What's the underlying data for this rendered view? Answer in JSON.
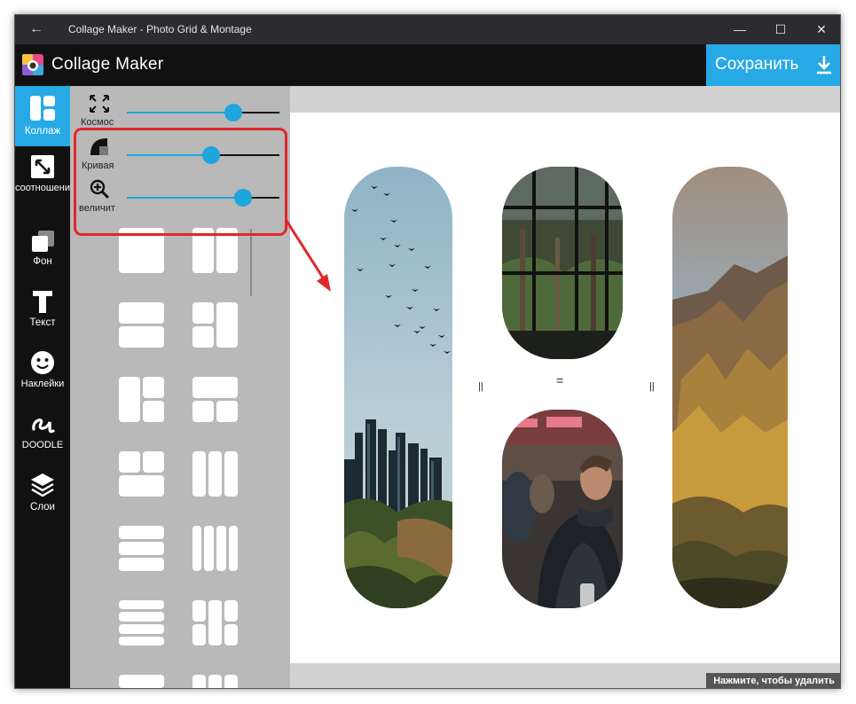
{
  "window": {
    "title": "Collage Maker - Photo Grid & Montage",
    "back_icon": "arrow-left-icon",
    "minimize_glyph": "—",
    "maximize_glyph": "☐",
    "close_glyph": "✕"
  },
  "appbar": {
    "name": "Collage Maker",
    "save_label": "Сохранить",
    "accent": "#27a9e6"
  },
  "nav": [
    {
      "label": "Коллаж",
      "icon": "collage-grid-icon",
      "active": true
    },
    {
      "label": "соотношение",
      "icon": "aspect-ratio-icon",
      "active": false
    },
    {
      "label": "Фон",
      "icon": "background-icon",
      "active": false
    },
    {
      "label": "Текст",
      "icon": "text-icon",
      "active": false
    },
    {
      "label": "Наклейки",
      "icon": "smiley-icon",
      "active": false
    },
    {
      "label": "DOODLE",
      "icon": "doodle-icon",
      "active": false
    },
    {
      "label": "Слои",
      "icon": "layers-icon",
      "active": false
    }
  ],
  "controls": {
    "space": {
      "label": "Космос",
      "value": 0.7
    },
    "curve": {
      "label": "Кривая",
      "value": 0.55
    },
    "zoom": {
      "label": "величит",
      "value": 0.76
    }
  },
  "canvas": {
    "tooltip": "Нажмите, чтобы удалить",
    "handle_vertical": "||",
    "handle_horizontal": "="
  }
}
